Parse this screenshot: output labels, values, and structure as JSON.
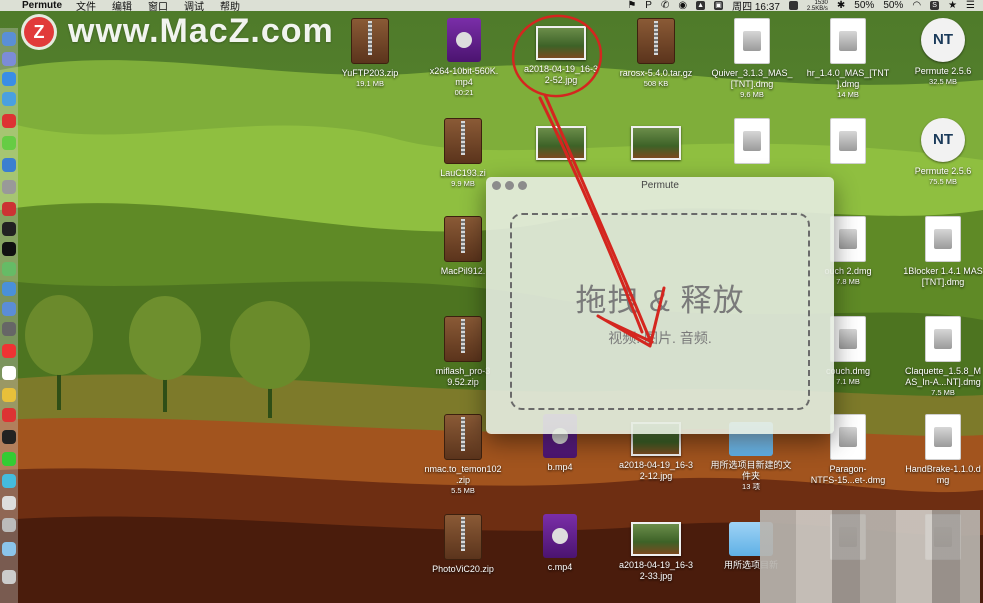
{
  "menubar": {
    "app_name": "Permute",
    "menus": [
      "文件",
      "编辑",
      "窗口",
      "调试",
      "帮助"
    ],
    "clock": "周四 16:37",
    "net_up": "1530",
    "net_down": "2.5KB/s",
    "battery_1": "50%",
    "battery_2": "50%"
  },
  "watermark": {
    "logo": "Z",
    "text": "www.MacZ.com"
  },
  "desktop_icons": [
    {
      "name": "YuFTP203.zip",
      "sub": "19.1 MB",
      "type": "zip"
    },
    {
      "name": "x264-10bit-560K.\nmp4",
      "sub": "00:21",
      "type": "mp4"
    },
    {
      "name": "a2018-04-19_16-3\n2-52.jpg",
      "sub": "",
      "type": "jpg"
    },
    {
      "name": "rarosx-5.4.0.tar.gz",
      "sub": "508 KB",
      "type": "zip"
    },
    {
      "name": "Quiver_3.1.3_MAS_\n[TNT].dmg",
      "sub": "9.6 MB",
      "type": "dmg"
    },
    {
      "name": "hr_1.4.0_MAS_[TNT\n].dmg",
      "sub": "14 MB",
      "type": "dmg"
    },
    {
      "name": "Permute 2.5.6",
      "sub": "32.5 MB",
      "type": "app"
    },
    {
      "name": "LauC193.zi",
      "sub": "9.9 MB",
      "type": "zip"
    },
    {
      "name": "",
      "sub": "",
      "type": "jpg"
    },
    {
      "name": "",
      "sub": "",
      "type": "jpg"
    },
    {
      "name": "",
      "sub": "",
      "type": "dmg"
    },
    {
      "name": "",
      "sub": "",
      "type": "dmg"
    },
    {
      "name": "Permute 2.5.6",
      "sub": "75.5 MB",
      "type": "app"
    },
    {
      "name": "MacPil912.",
      "sub": "",
      "type": "zip"
    },
    {
      "name": "ouch 2.dmg",
      "sub": "7.8 MB",
      "type": "dmg"
    },
    {
      "name": "1Blocker 1.4.1 MAS\n[TNT].dmg",
      "sub": "",
      "type": "dmg"
    },
    {
      "name": "miflash_pro-3\n9.52.zip",
      "sub": "",
      "type": "zip"
    },
    {
      "name": "couch.dmg",
      "sub": "7.1 MB",
      "type": "dmg"
    },
    {
      "name": "Claquette_1.5.8_M\nAS_In-A...NT].dmg",
      "sub": "7.5 MB",
      "type": "dmg"
    },
    {
      "name": "nmac.to_temon102\n.zip",
      "sub": "5.5 MB",
      "type": "zip"
    },
    {
      "name": "b.mp4",
      "sub": "",
      "type": "mp4"
    },
    {
      "name": "a2018-04-19_16-3\n2-12.jpg",
      "sub": "",
      "type": "jpg"
    },
    {
      "name": "用所选项目新建的文\n件夹",
      "sub": "13 项",
      "type": "folder"
    },
    {
      "name": "Paragon-\nNTFS-15...et-.dmg",
      "sub": "",
      "type": "dmg"
    },
    {
      "name": "HandBrake-1.1.0.d\nmg",
      "sub": "",
      "type": "dmg"
    },
    {
      "name": "PhotoViC20.zip",
      "sub": "",
      "type": "zip"
    },
    {
      "name": "c.mp4",
      "sub": "",
      "type": "mp4"
    },
    {
      "name": "a2018-04-19_16-3\n2-33.jpg",
      "sub": "",
      "type": "jpg"
    },
    {
      "name": "用所选项目新",
      "sub": "",
      "type": "folder"
    },
    {
      "name": "",
      "sub": "",
      "type": "dmg"
    },
    {
      "name": "",
      "sub": "",
      "type": "dmg"
    }
  ],
  "permute_window": {
    "title": "Permute",
    "drop_title": "拖拽 & 释放",
    "drop_subtitle": "视频. 图片. 音频."
  },
  "colors": {
    "annotation_red": "#d4261f",
    "watermark_logo": "#e13a3a",
    "window_bg": "#e5ece1"
  }
}
